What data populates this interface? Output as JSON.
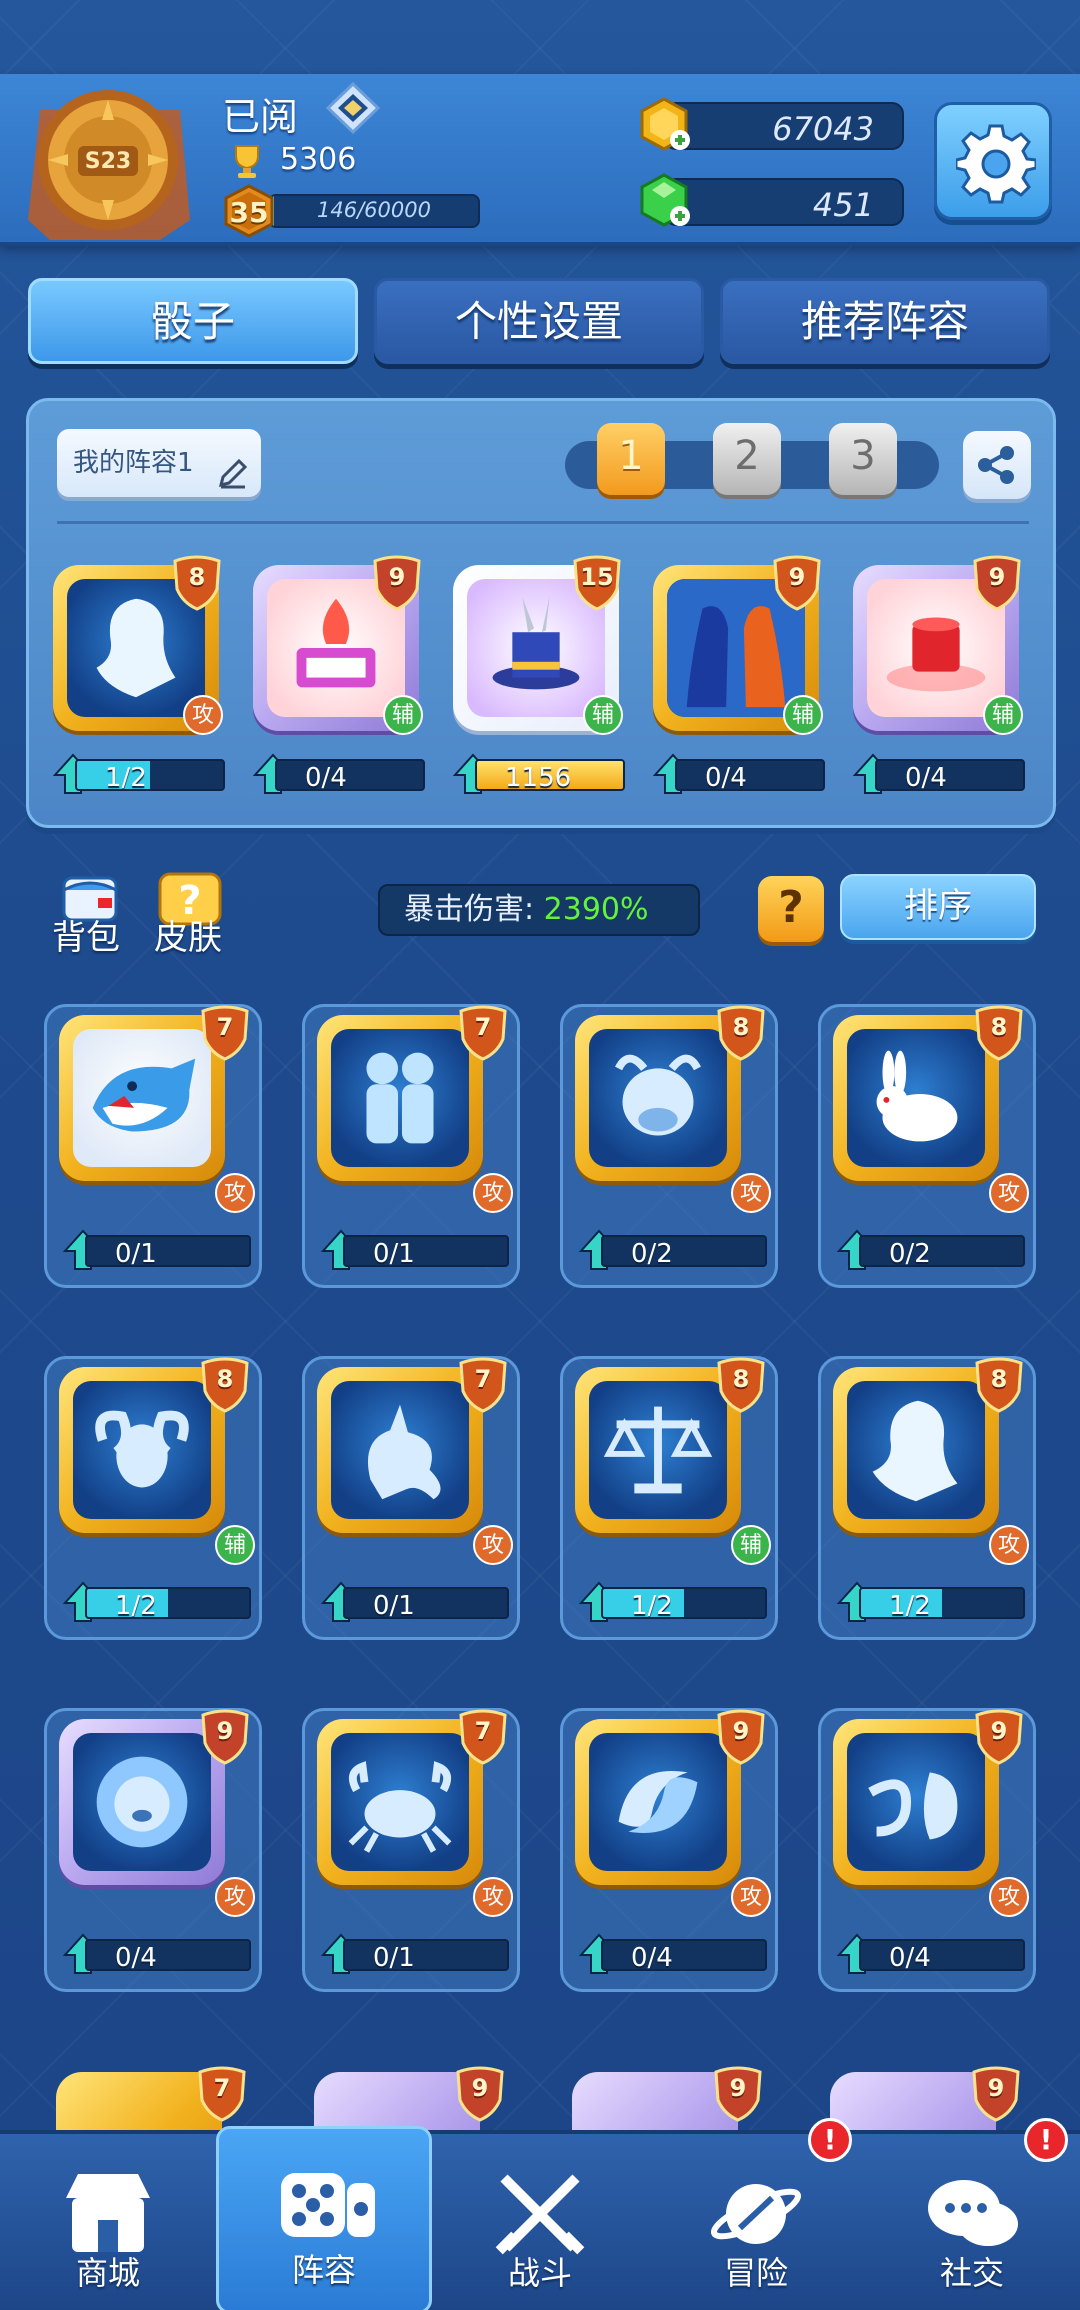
{
  "header": {
    "season_badge": "S23",
    "player_name": "已阅",
    "trophies": "5306",
    "level": "35",
    "xp_text": "146/60000",
    "xp_fraction": 0.0024,
    "coins": "67043",
    "gems": "451"
  },
  "tabs": [
    {
      "label": "骰子",
      "active": true
    },
    {
      "label": "个性设置",
      "active": false
    },
    {
      "label": "推荐阵容",
      "active": false
    }
  ],
  "deck": {
    "name": "我的阵容1",
    "slots": [
      "1",
      "2",
      "3"
    ],
    "active_slot": 0,
    "dice": [
      {
        "name": "virgo-dice",
        "level": "8",
        "role": "攻",
        "progress": "1/2",
        "fraction": 0.5,
        "frame": "gold",
        "inner": "dark",
        "icon": "maiden-silhouette"
      },
      {
        "name": "altar-dice",
        "level": "9",
        "role": "辅",
        "progress": "0/4",
        "fraction": 0,
        "frame": "purple",
        "inner": "pink",
        "icon": "flame-altar"
      },
      {
        "name": "magic-hat-dice",
        "level": "15",
        "role": "辅",
        "progress": "1156",
        "fraction": 1,
        "frame": "white",
        "inner": "magic",
        "icon": "magic-hat"
      },
      {
        "name": "twin-figure-dice",
        "level": "9",
        "role": "辅",
        "progress": "0/4",
        "fraction": 0,
        "frame": "gold",
        "inner": "dark",
        "icon": "twin-figures"
      },
      {
        "name": "red-hat-dice",
        "level": "9",
        "role": "辅",
        "progress": "0/4",
        "fraction": 0,
        "frame": "purple",
        "inner": "pink",
        "icon": "red-hat"
      }
    ]
  },
  "toolbar": {
    "bag_label": "背包",
    "skin_label": "皮肤",
    "crit_label": "暴击伤害:",
    "crit_value": "2390%",
    "help_label": "?",
    "sort_label": "排序"
  },
  "collection": [
    {
      "name": "shark-dice",
      "level": "7",
      "role": "攻",
      "progress": "0/1",
      "fraction": 0,
      "inner": "light",
      "icon": "shark"
    },
    {
      "name": "gemini-dice",
      "level": "7",
      "role": "攻",
      "progress": "0/1",
      "fraction": 0,
      "inner": "dark",
      "icon": "twins"
    },
    {
      "name": "taurus-dice",
      "level": "8",
      "role": "攻",
      "progress": "0/2",
      "fraction": 0,
      "inner": "dark",
      "icon": "bull"
    },
    {
      "name": "rabbit-dice",
      "level": "8",
      "role": "攻",
      "progress": "0/2",
      "fraction": 0,
      "inner": "dark",
      "icon": "rabbit"
    },
    {
      "name": "aries-dice",
      "level": "8",
      "role": "辅",
      "progress": "1/2",
      "fraction": 0.5,
      "inner": "dark",
      "icon": "ram"
    },
    {
      "name": "capricorn-dice",
      "level": "7",
      "role": "攻",
      "progress": "0/1",
      "fraction": 0,
      "inner": "dark",
      "icon": "goat"
    },
    {
      "name": "libra-dice",
      "level": "8",
      "role": "辅",
      "progress": "1/2",
      "fraction": 0.5,
      "inner": "dark",
      "icon": "scales"
    },
    {
      "name": "virgo-dice-2",
      "level": "8",
      "role": "攻",
      "progress": "1/2",
      "fraction": 0.5,
      "inner": "dark",
      "icon": "maiden"
    },
    {
      "name": "leo-dice",
      "level": "9",
      "role": "攻",
      "progress": "0/4",
      "fraction": 0,
      "inner": "dark",
      "icon": "lion",
      "frame": "purple"
    },
    {
      "name": "cancer-dice",
      "level": "7",
      "role": "攻",
      "progress": "0/1",
      "fraction": 0,
      "inner": "dark",
      "icon": "crab"
    },
    {
      "name": "pisces-dice",
      "level": "9",
      "role": "攻",
      "progress": "0/4",
      "fraction": 0,
      "inner": "dark",
      "icon": "fish-swirl"
    },
    {
      "name": "aquarius-dice",
      "level": "9",
      "role": "攻",
      "progress": "0/4",
      "fraction": 0,
      "inner": "dark",
      "icon": "water-jar"
    }
  ],
  "partial_row_levels": [
    "7",
    "9",
    "9",
    "9"
  ],
  "bottom_nav": [
    {
      "label": "商城",
      "icon": "shop-icon",
      "active": false,
      "alert": false
    },
    {
      "label": "阵容",
      "icon": "dice-icon",
      "active": true,
      "alert": false
    },
    {
      "label": "战斗",
      "icon": "swords-icon",
      "active": false,
      "alert": false
    },
    {
      "label": "冒险",
      "icon": "planet-icon",
      "active": false,
      "alert": true
    },
    {
      "label": "社交",
      "icon": "chat-icon",
      "active": false,
      "alert": true
    }
  ],
  "alert_mark": "!"
}
